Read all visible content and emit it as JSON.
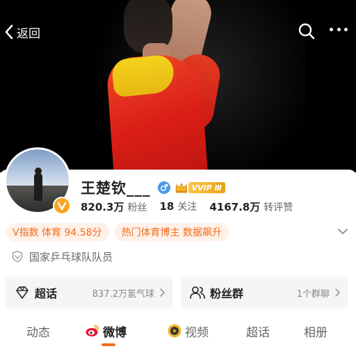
{
  "header": {
    "back_label": "返回",
    "search_icon": "search-icon",
    "more_icon": "more-horizontal-icon"
  },
  "profile": {
    "name": "王楚钦___",
    "gender_icon": "male-icon",
    "vip_badge": "VVIP Ⅲ",
    "verified_icon": "verified-v-icon",
    "stats": [
      {
        "num": "820.3万",
        "label": "粉丝"
      },
      {
        "num": "18",
        "label": "关注"
      },
      {
        "num": "4167.8万",
        "label": "转评赞"
      }
    ],
    "tags": [
      "V指数 体育 94.58分",
      "热门体育博主 数据飙升"
    ],
    "certification": "国家乒乓球队队员"
  },
  "cards": {
    "topic": {
      "title": "超话",
      "subtitle": "837.2万氢气球"
    },
    "fans": {
      "title": "粉丝群",
      "subtitle": "1个群聊"
    }
  },
  "tabs": [
    {
      "label": "动态"
    },
    {
      "label": "微博"
    },
    {
      "label": "视频"
    },
    {
      "label": "超话"
    },
    {
      "label": "相册"
    }
  ],
  "colors": {
    "accent": "#f26b1d",
    "tag_bg": "#fff1e8",
    "vip_gold": "#f5a623"
  }
}
